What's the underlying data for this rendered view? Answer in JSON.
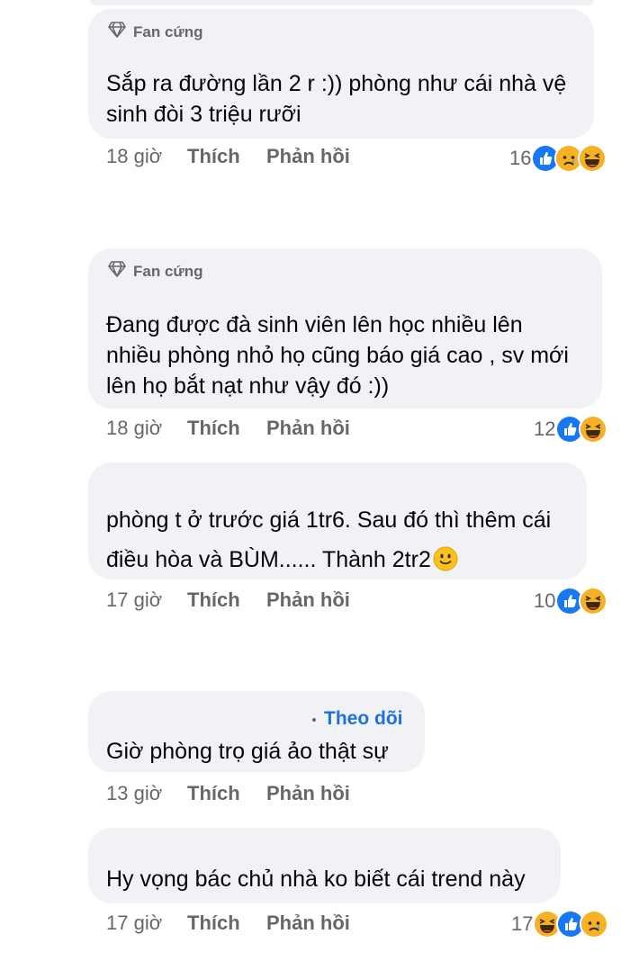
{
  "comments": [
    {
      "badge": "Fan cứng",
      "text_lines": [
        "Sắp ra đường lần 2 r :)) phòng như cái nhà vệ",
        "sinh đòi 3 triệu rưỡi"
      ],
      "time": "18 giờ",
      "like": "Thích",
      "reply": "Phản hồi",
      "reaction_count": "16",
      "reactions": [
        "like",
        "sad",
        "haha"
      ]
    },
    {
      "badge": "Fan cứng",
      "text_lines": [
        "Đang được đà sinh viên lên học nhiều lên",
        "nhiều phòng nhỏ họ cũng báo giá cao , sv mới",
        "lên họ bắt nạt như vậy đó :))"
      ],
      "time": "18 giờ",
      "like": "Thích",
      "reply": "Phản hồi",
      "reaction_count": "12",
      "reactions": [
        "like",
        "haha"
      ]
    },
    {
      "text_lines": [
        "phòng t ở trước giá  1tr6. Sau đó thì thêm cái",
        "điều hòa và BÙM...... Thành 2tr2"
      ],
      "inline_emoji": "slight-smile",
      "time": "17 giờ",
      "like": "Thích",
      "reply": "Phản hồi",
      "reaction_count": "10",
      "reactions": [
        "like",
        "haha"
      ]
    },
    {
      "follow": "Theo dõi",
      "text_lines": [
        "Giờ phòng trọ giá ảo thật sự"
      ],
      "time": "13 giờ",
      "like": "Thích",
      "reply": "Phản hồi"
    },
    {
      "text_lines": [
        "Hy vọng bác chủ nhà ko biết cái trend này"
      ],
      "time": "17 giờ",
      "like": "Thích",
      "reply": "Phản hồi",
      "reaction_count": "17",
      "reactions": [
        "haha",
        "like",
        "sad"
      ]
    }
  ],
  "colors": {
    "bubble": "#f0f2f5",
    "meta": "#65676b",
    "link": "#216fdb",
    "like": "#1877f2",
    "haha": "#f7b125"
  }
}
